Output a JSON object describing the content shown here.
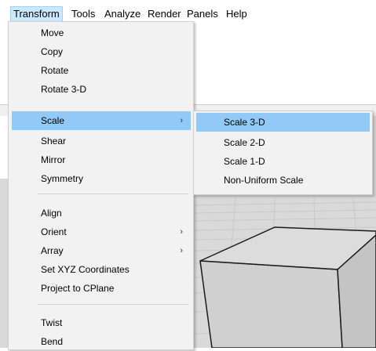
{
  "menubar": {
    "items": [
      "Transform",
      "Tools",
      "Analyze",
      "Render",
      "Panels",
      "Help"
    ],
    "active": "Transform"
  },
  "transform_menu": {
    "groups": [
      [
        {
          "label": "Move"
        },
        {
          "label": "Copy"
        },
        {
          "label": "Rotate"
        },
        {
          "label": "Rotate 3-D"
        },
        {
          "label": "Scale",
          "arrow": "›",
          "highlighted": true
        },
        {
          "label": "Shear"
        },
        {
          "label": "Mirror"
        },
        {
          "label": "Symmetry"
        }
      ],
      [
        {
          "label": "Align"
        },
        {
          "label": "Orient",
          "arrow": "›"
        },
        {
          "label": "Array",
          "arrow": "›"
        },
        {
          "label": "Set XYZ Coordinates"
        },
        {
          "label": "Project to CPlane"
        }
      ],
      [
        {
          "label": "Twist"
        },
        {
          "label": "Bend"
        }
      ]
    ]
  },
  "scale_submenu": {
    "items": [
      "Scale 3-D",
      "Scale 2-D",
      "Scale 1-D",
      "Non-Uniform Scale"
    ],
    "highlighted": "Scale 3-D"
  },
  "colors": {
    "menu_bg": "#f2f2f2",
    "highlight": "#91c9f7",
    "menubar_active": "#cce8ff",
    "viewport_bg": "#d9d9d9"
  }
}
